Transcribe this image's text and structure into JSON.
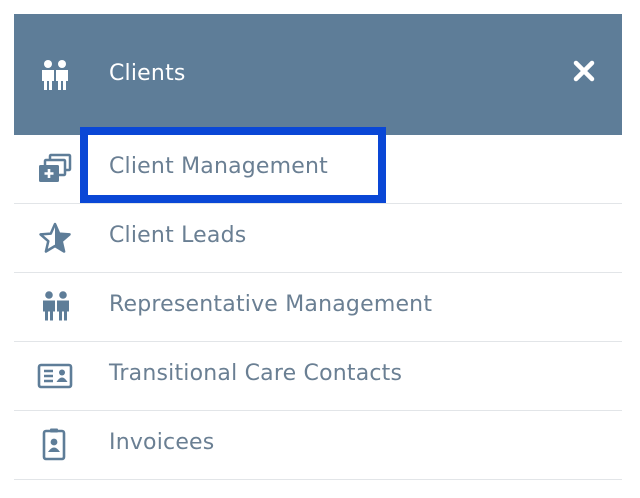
{
  "header": {
    "title": "Clients",
    "icon": "people-icon",
    "close_icon": "close-icon"
  },
  "menu": {
    "items": [
      {
        "label": "Client Management",
        "icon": "client-management-icon",
        "highlighted": true
      },
      {
        "label": "Client Leads",
        "icon": "star-icon",
        "highlighted": false
      },
      {
        "label": "Representative Management",
        "icon": "people-icon",
        "highlighted": false
      },
      {
        "label": "Transitional Care Contacts",
        "icon": "contact-card-icon",
        "highlighted": false
      },
      {
        "label": "Invoicees",
        "icon": "id-badge-icon",
        "highlighted": false
      }
    ]
  },
  "colors": {
    "header_bg": "#5e7d98",
    "icon": "#5e7d98",
    "text": "#6a7f93",
    "highlight": "#0a47d6"
  }
}
